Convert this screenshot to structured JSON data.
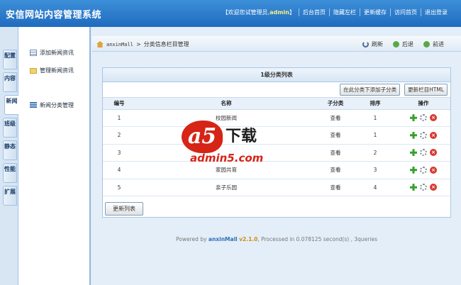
{
  "header": {
    "app_title": "安信网站内容管理系统",
    "welcome_prefix": "【欢迎您试管理员,",
    "welcome_user": "admin",
    "welcome_suffix": "】",
    "links": [
      "后台首页",
      "隐藏左栏",
      "更新缓存",
      "访问首页",
      "退出登录"
    ]
  },
  "vtabs": [
    "配置",
    "内容",
    "新闻",
    "班级",
    "静态",
    "性能",
    "扩展"
  ],
  "sidebar": {
    "items": [
      "添加新闻资讯",
      "管理新闻资讯",
      "新闻分类管理"
    ]
  },
  "toolbar": {
    "site": "anxinMall",
    "separator": ">",
    "breadcrumb": "分类信息栏目管理",
    "refresh": "刷新",
    "back": "后退",
    "forward": "前进"
  },
  "panel": {
    "title": "1级分类列表",
    "add_child_btn": "在此分类下添加子分类",
    "update_column_btn": "更新栏目HTML",
    "columns": [
      "编号",
      "名称",
      "子分类",
      "排序",
      "操作"
    ],
    "rows": [
      {
        "id": "1",
        "name": "校园新闻",
        "sub": "查看",
        "order": "1"
      },
      {
        "id": "2",
        "name": "",
        "sub": "查看",
        "order": "1"
      },
      {
        "id": "3",
        "name": "",
        "sub": "查看",
        "order": "2"
      },
      {
        "id": "4",
        "name": "家园共育",
        "sub": "查看",
        "order": "3"
      },
      {
        "id": "5",
        "name": "亲子乐园",
        "sub": "查看",
        "order": "4"
      }
    ],
    "update_list_btn": "更新列表"
  },
  "footer": {
    "prefix": "Powered by",
    "brand": "anxinMall",
    "version": "v2.1.0",
    "stats": ", Processed in 0.078125 second(s) , 3queries"
  },
  "watermark": {
    "logo": "a5",
    "text": "下载",
    "url": "admin5.com"
  }
}
